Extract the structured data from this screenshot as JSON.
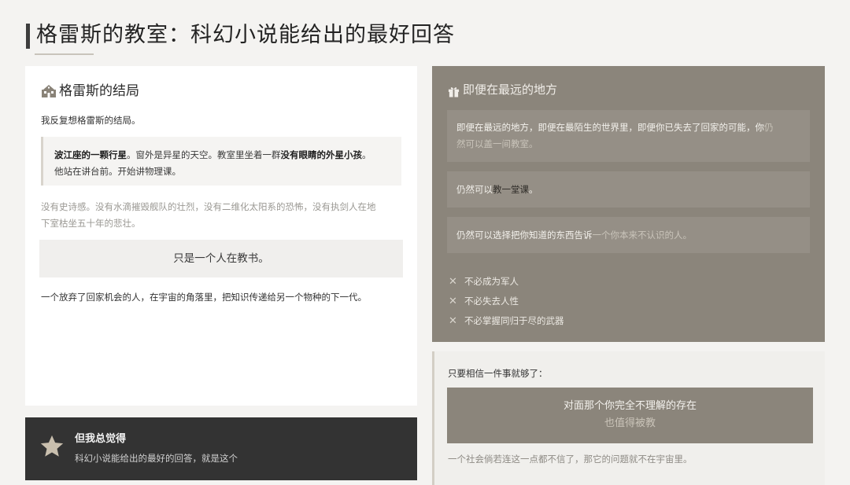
{
  "page": {
    "title": "格雷斯的教室：科幻小说能给出的最好回答"
  },
  "left_card": {
    "heading": "格雷斯的结局",
    "heading_icon": "school-icon",
    "intro": "我反复想格雷斯的结局。",
    "quote": {
      "bold1": "波江座的一颗行星",
      "text1": "。窗外是异星的天空。教室里坐着一群",
      "bold2": "没有眼睛的外星小孩",
      "text2": "。",
      "line2": "他站在讲台前。开始讲物理课。"
    },
    "muted_line1": "没有史诗感。没有水滴摧毁舰队的壮烈，没有二维化太阳系的恐怖，没有执剑人在地",
    "muted_line2": "下室枯坐五十年的悲壮。",
    "center_text": "只是一个人在教书。",
    "closing": "一个放弃了回家机会的人，在宇宙的角落里，把知识传递给另一个物种的下一代。"
  },
  "dark_card": {
    "icon": "star-icon",
    "heading": "但我总觉得",
    "subtext": "科幻小说能给出的最好的回答，就是这个"
  },
  "right_card": {
    "heading": "即便在最远的地方",
    "heading_icon": "gift-icon",
    "box1_line1_a": "即便在最远的地方，即便在最陌生的世界里，即便你已失去了回家的可能，你",
    "box1_line1_b": "仍",
    "box1_line2": "然可以盖一间教室。",
    "box2_a": "仍然可以",
    "box2_b": "教一堂课",
    "box2_c": "。",
    "box3_a": "仍然可以选择把你知道的东西告诉",
    "box3_b": "一个你本来不认识的人。",
    "x_items": [
      "不必成为军人",
      "不必失去人性",
      "不必掌握同归于尽的武器"
    ]
  },
  "bottom_right": {
    "label": "只要相信一件事就够了：",
    "box_line1": "对面那个你完全不理解的存在",
    "box_line2": "也值得被教",
    "footer": "一个社会倘若连这一点都不信了，那它的问题就不在宇宙里。"
  },
  "colors": {
    "background": "#f4f3f1",
    "card_white": "#ffffff",
    "card_dark": "#333333",
    "card_taupe": "#8b857b",
    "accent_star": "#c9bfae"
  }
}
